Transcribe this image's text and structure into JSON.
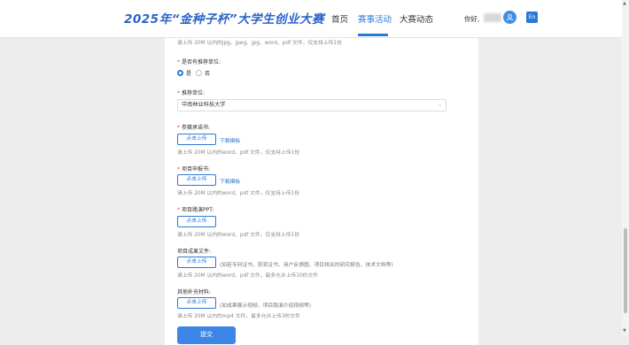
{
  "header": {
    "brand": "2025年“金种子杯”大学生创业大赛",
    "nav": [
      "首页",
      "赛事活动",
      "大赛动态"
    ],
    "active_nav": "赛事活动",
    "greeting": "你好,",
    "lang_button": "En"
  },
  "form": {
    "top_hint": "请上传 20M 以内的jpg、jpeg、jpg、word、pdf 文件，仅支持上传1份",
    "recommend": {
      "label": "是否有推荐单位:",
      "options": [
        "是",
        "否"
      ],
      "selected": "是"
    },
    "advisor_unit": {
      "label": "推荐单位:",
      "value": "中南林业科技大学"
    },
    "commitment": {
      "label": "参赛承诺书:",
      "upload": "点击上传",
      "download": "下载模板",
      "hint": "请上传 20M 以内的word、pdf 文件，仅支持上传1份"
    },
    "application": {
      "label": "项目申报书:",
      "upload": "点击上传",
      "download": "下载模板",
      "hint": "请上传 20M 以内的word、pdf 文件，仅支持上传1份"
    },
    "ppt": {
      "label": "项目路演PPT:",
      "upload": "点击上传",
      "hint": "请上传 20M 以内的word、pdf 文件，仅支持上传1份"
    },
    "results": {
      "label": "项目成果文件:",
      "upload": "点击上传",
      "desc": "(如若专利证书、获奖证书、用户反馈图、项目相关的研究报告、技术文档等)",
      "hint": "请上传 20M 以内的word、pdf 文件，最多允许上传10份文件"
    },
    "other": {
      "label": "其他补充材料:",
      "upload": "点击上传",
      "desc": "(如成果展示视频、项目路演介绍视频等)",
      "hint": "请上传 20M 以内的mp4 文件，最多允许上传3份文件"
    },
    "submit": "提交"
  },
  "colors": {
    "accent": "#2a78d8",
    "required": "#e23c3c"
  }
}
